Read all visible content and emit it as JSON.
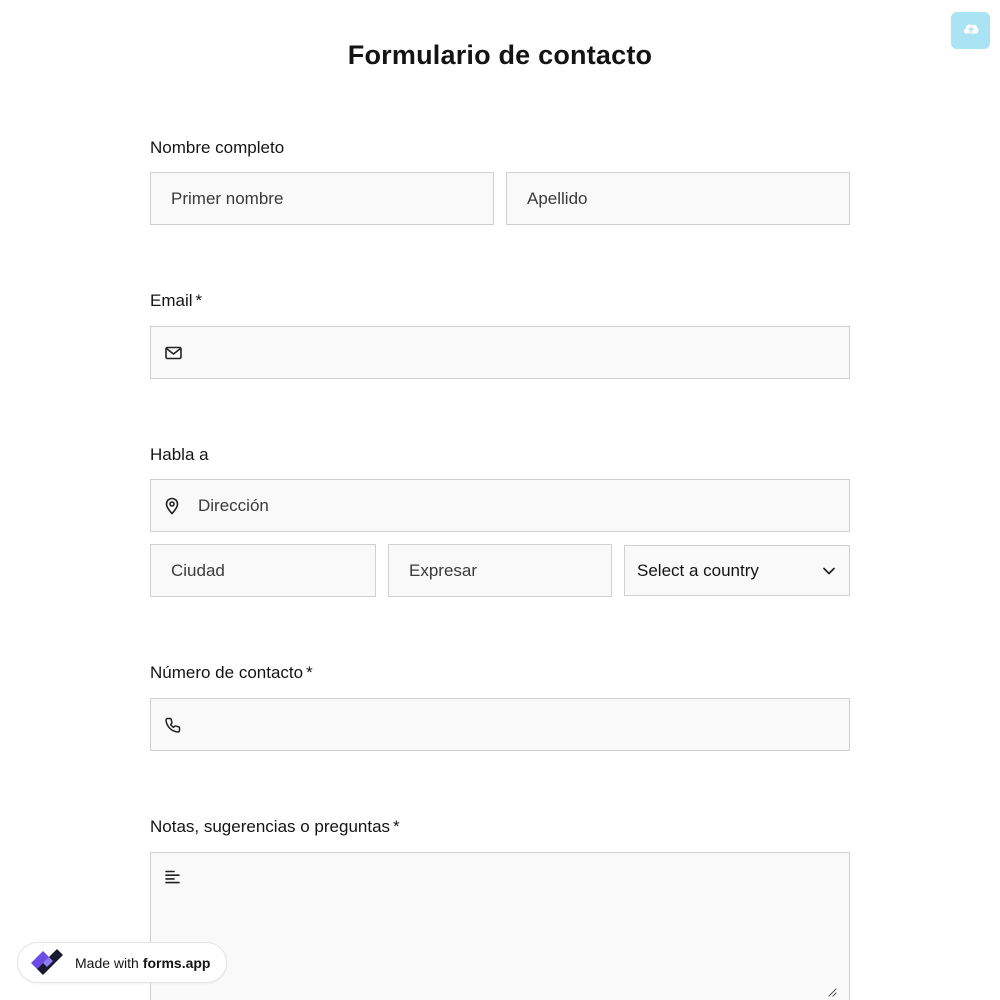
{
  "header": {
    "title": "Formulario de contacto"
  },
  "toolbar": {
    "cloud_icon": "cloud-upload-icon"
  },
  "full_name": {
    "label": "Nombre completo",
    "first_placeholder": "Primer nombre",
    "last_placeholder": "Apellido"
  },
  "email": {
    "label": "Email",
    "required_mark": "*",
    "icon": "mail-icon",
    "value": ""
  },
  "address": {
    "label": "Habla a",
    "street_placeholder": "Dirección",
    "street_icon": "map-pin-icon",
    "city_placeholder": "Ciudad",
    "state_placeholder": "Expresar",
    "country_selected": "Select a country"
  },
  "phone": {
    "label": "Número de contacto",
    "required_mark": "*",
    "icon": "phone-icon",
    "value": ""
  },
  "notes": {
    "label": "Notas, sugerencias o preguntas",
    "required_mark": "*",
    "icon": "text-lines-icon",
    "value": ""
  },
  "footer_badge": {
    "prefix": "Made with",
    "brand": "forms.app"
  },
  "colors": {
    "cloud_button_bg": "#a9e3f4",
    "field_bg": "#f9f9f9",
    "field_border": "#d0d0d0",
    "logo_purple": "#6b4ce6"
  }
}
